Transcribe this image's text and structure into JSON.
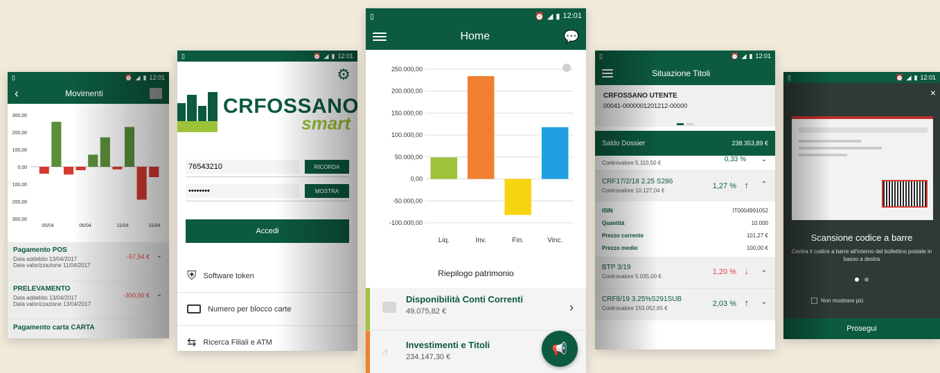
{
  "status": {
    "time": "12:01"
  },
  "movimenti": {
    "title": "Movimenti",
    "yticks": [
      "300,00",
      "200,00",
      "100,00",
      "0,00",
      "100,00",
      "200,00",
      "300,00"
    ],
    "xticks": [
      "05/04",
      "06/04",
      "11/04",
      "11/04"
    ],
    "bars": [
      -40,
      260,
      -45,
      -20,
      70,
      170,
      -15,
      230,
      -190,
      -60
    ],
    "items": [
      {
        "title": "Pagamento POS",
        "date1": "Data addebito 13/04/2017",
        "date2": "Data valorizzazione 11/04/2017",
        "amount": "-57,54 €"
      },
      {
        "title": "PRELEVAMENTO",
        "date1": "Data addebito 13/04/2017",
        "date2": "Data valorizzazione 13/04/2017",
        "amount": "-300,00 €"
      },
      {
        "title": "Pagamento carta CARTA"
      }
    ]
  },
  "login": {
    "logo_main": "CRFOSSANO",
    "logo_sub": "smart",
    "user_value": "76543210",
    "remember_label": "RICORDA",
    "password_value": "••••••••",
    "show_label": "MOSTRA",
    "login_label": "Accedi",
    "menu": [
      {
        "label": "Software token",
        "icon": "shield-icon"
      },
      {
        "label": "Numero per blocco carte",
        "icon": "card-icon"
      },
      {
        "label": "Ricerca Filiali e ATM",
        "icon": "signpost-icon"
      }
    ]
  },
  "home": {
    "title": "Home",
    "chart_title": "Riepilogo patrimonio",
    "list": [
      {
        "title": "Disponibilità Conti Correnti",
        "amount": "49.075,82 €",
        "color": "#9dc33b"
      },
      {
        "title": "Investimenti e Titoli",
        "amount": "234.147,30 €",
        "color": "#f08030"
      }
    ]
  },
  "chart_data": {
    "type": "bar",
    "title": "Riepilogo patrimonio",
    "categories": [
      "Liq.",
      "Inv.",
      "Fin.",
      "Vinc."
    ],
    "values": [
      49075.82,
      234147.3,
      -82000,
      118000
    ],
    "colors": [
      "#9dc33b",
      "#f08030",
      "#f7d410",
      "#1f9fe0"
    ],
    "yticks": [
      "250.000,00",
      "200.000,00",
      "150.000,00",
      "100.000,00",
      "50.000,00",
      "0,00",
      "-50.000,00",
      "-100.000,00"
    ],
    "ylim": [
      -100000,
      250000
    ],
    "grid": true
  },
  "titoli": {
    "title": "Situazione Titoli",
    "user": "CRFOSSANO UTENTE",
    "account": "00041-0000001201212-00000",
    "saldo_label": "Saldo Dossier",
    "saldo_value": "238.353,89 €",
    "partial_label": "Controvalore 5.110,50 €",
    "partial_pct": "0,33 %",
    "expanded": {
      "name": "CRF17/2/18 2.25 S286",
      "sub": "Controvalore 10.127,04 €",
      "pct": "1,27 %",
      "details": [
        {
          "k": "ISIN",
          "v": "IT0004991052"
        },
        {
          "k": "Quantità",
          "v": "10.000"
        },
        {
          "k": "Prezzo corrente",
          "v": "101,27 €"
        },
        {
          "k": "Prezzo medio",
          "v": "100,00 €"
        }
      ]
    },
    "items": [
      {
        "name": "BTP 3/19",
        "sub": "Controvalore 5.035,00 €",
        "pct": "1,20 %",
        "dir": "down"
      },
      {
        "name": "CRF8/19 3.25%S291SUB",
        "sub": "Controvalore 153.052,65 €",
        "pct": "2,03 %",
        "dir": "up"
      }
    ]
  },
  "scan": {
    "title": "Scansione codice a barre",
    "desc": "Centra il codice a barre all'interno del bollettino postale in basso a destra",
    "checkbox_label": "Non mostrare più",
    "button_label": "Prosegui"
  }
}
